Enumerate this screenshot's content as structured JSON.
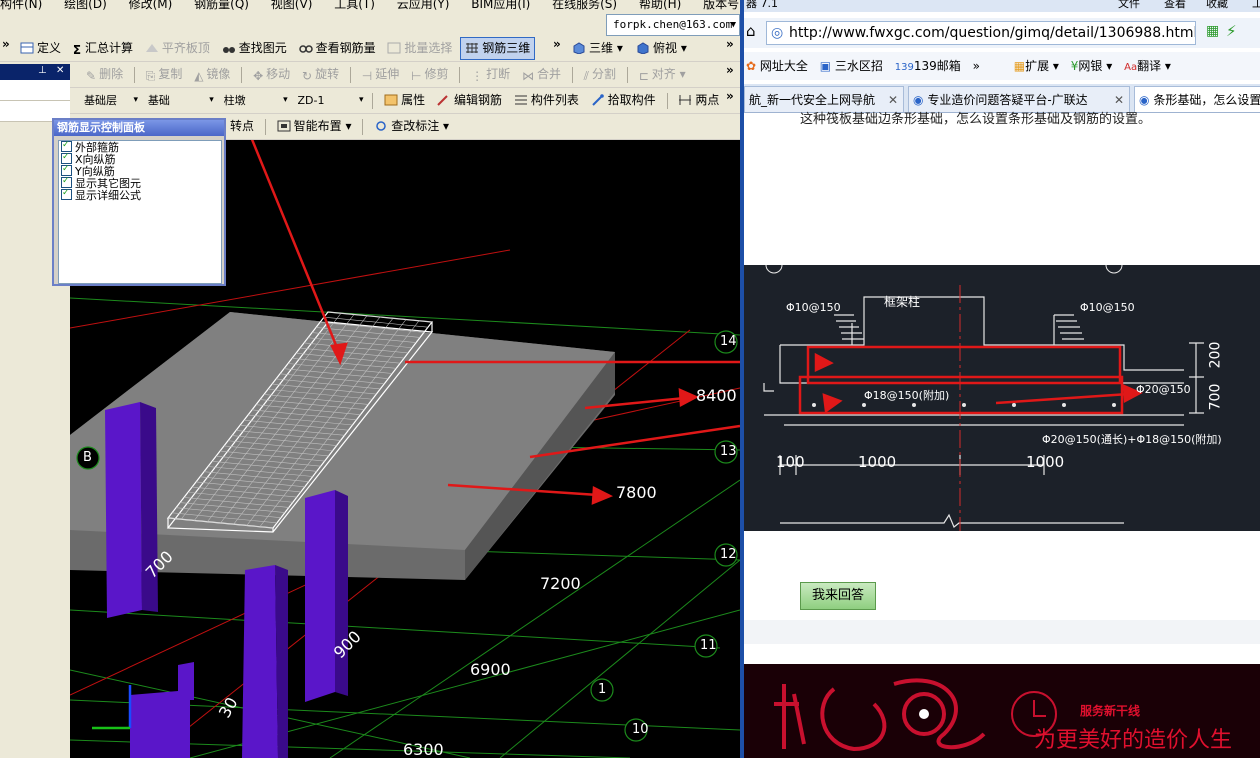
{
  "left_app": {
    "menu": [
      "构件(N)",
      "绘图(D)",
      "修改(M)",
      "钢筋量(Q)",
      "视图(V)",
      "工具(T)",
      "云应用(Y)",
      "BIM应用(I)",
      "在线服务(S)",
      "帮助(H)",
      "版本号(B)"
    ],
    "user_email": "forpk.chen@163.com",
    "toolbar1": {
      "define": "定义",
      "sum_calc": "汇总计算",
      "flush_board_top": "平齐板顶",
      "find_element": "查找图元",
      "view_rebar_qty": "查看钢筋量",
      "batch_select": "批量选择",
      "rebar_3d": "钢筋三维",
      "view_3d": "三维",
      "top_view": "俯视"
    },
    "toolbar2": {
      "delete": "删除",
      "copy": "复制",
      "mirror": "镜像",
      "move": "移动",
      "rotate": "旋转",
      "extend": "延伸",
      "trim": "修剪",
      "break": "打断",
      "merge": "合并",
      "split": "分割",
      "align": "对齐"
    },
    "toolbar3": {
      "layer": "基础层",
      "category": "基础",
      "type": "柱墩",
      "element": "ZD-1",
      "property": "属性",
      "edit_rebar": "编辑钢筋",
      "element_list": "构件列表",
      "pick_element": "拾取构件",
      "two_points": "两点"
    },
    "toolbar4": {
      "rotate_point": "转点",
      "smart_layout": "智能布置",
      "modify_label": "查改标注"
    },
    "control_panel": {
      "title": "钢筋显示控制面板",
      "options": [
        "外部箍筋",
        "X向纵筋",
        "Y向纵筋",
        "显示其它图元",
        "显示详细公式"
      ]
    },
    "viewport": {
      "axis_numbers": [
        "14",
        "13",
        "12",
        "11",
        "10",
        "1"
      ],
      "axis_letter": "B",
      "dims": [
        "8400",
        "7800",
        "7200",
        "6900",
        "6300",
        "700",
        "900",
        "30"
      ]
    }
  },
  "browser": {
    "top_menu": [
      "文件",
      "查看",
      "收藏",
      "工"
    ],
    "top_left_text": "器 7.1",
    "url": "http://www.fwxgc.com/question/gimq/detail/1306988.html#ans",
    "bookmarks": [
      "网址大全",
      "三水区招",
      "139邮箱",
      "扩展",
      "网银",
      "翻译"
    ],
    "tabs": [
      {
        "label": "航_新一代安全上网导航"
      },
      {
        "label": "专业造价问题答疑平台-广联达"
      },
      {
        "label": "条形基础，怎么设置"
      }
    ],
    "question_text": "这种筏板基础边条形基础，怎么设置条形基础及钢筋的设置。",
    "cad": {
      "frame_column": "框架柱",
      "rebar_left": "Φ10@150",
      "rebar_right": "Φ10@150",
      "rebar_mid": "Φ18@150(附加)",
      "rebar_side": "Φ20@150",
      "rebar_bottom": "Φ20@150(通长)+Φ18@150(附加)",
      "dim_200": "200",
      "dim_700": "700",
      "dim_100": "100",
      "dim_1000a": "1000",
      "dim_1000b": "1000"
    },
    "answer_button": "我来回答",
    "banner": {
      "slogan": "为更美好的造价人生",
      "service": "服务新干线"
    }
  }
}
